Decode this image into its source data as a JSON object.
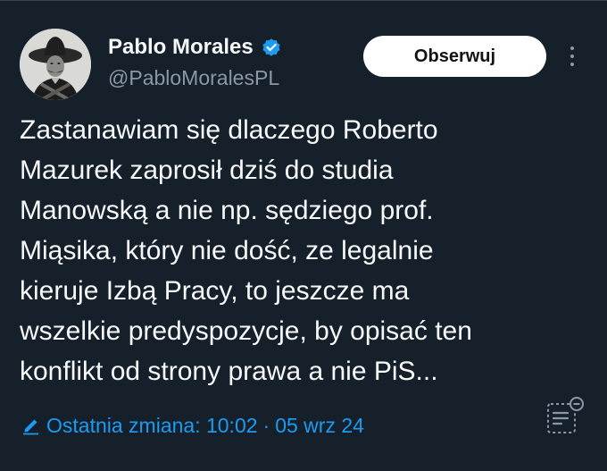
{
  "tweet": {
    "author": {
      "display_name": "Pablo Morales",
      "handle": "@PabloMoralesPL",
      "verified": true
    },
    "follow_label": "Obserwuj",
    "text_lines": [
      "Zastanawiam się dlaczego Roberto",
      "Mazurek zaprosił dziś do studia",
      "Manowską a nie np. sędziego prof.",
      "Miąsika, który nie dość, ze legalnie",
      "kieruje Izbą Pracy, to jeszcze ma",
      "wszelkie predyspozycje, by opisać ten",
      "konflikt od strony prawa a nie PiS..."
    ],
    "edit_info": {
      "label": "Ostatnia zmiana: 10:02",
      "separator": "·",
      "date": "05 wrz 24"
    }
  },
  "colors": {
    "background": "#15202b",
    "text_primary": "#f7f9f9",
    "text_secondary": "#8b98a5",
    "accent": "#1d9bf0",
    "follow_button_bg": "#ffffff",
    "follow_button_text": "#0f1419"
  },
  "icons": {
    "verified": "verified-badge-icon",
    "more": "more-dots-icon",
    "edit": "pencil-icon",
    "notes": "community-notes-icon"
  }
}
